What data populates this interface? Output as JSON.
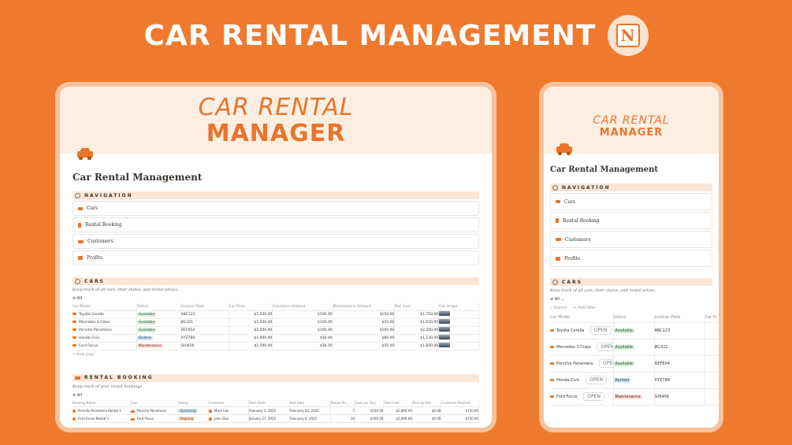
{
  "hero": {
    "title": "CAR RENTAL MANAGEMENT",
    "logo_letter": "N"
  },
  "banner": {
    "line1": "CAR RENTAL",
    "line2": "MANAGER"
  },
  "page": {
    "title": "Car Rental Management"
  },
  "navigation": {
    "heading": "NAVIGATION",
    "items": [
      "Cars",
      "Rental Booking",
      "Customers",
      "Profits"
    ]
  },
  "cars": {
    "heading": "CARS",
    "caption": "Keep track of all cars, their status, and rental prices.",
    "view": "All",
    "view_mobile": "All ⌄",
    "search": "Search",
    "add_filter": "+ Add filter",
    "columns": [
      "Car Model",
      "Status",
      "License Plate",
      "Car Price",
      "Insurance Amount",
      "Maintenance Amount",
      "Net Cost",
      "Car Image"
    ],
    "columns_mobile": [
      "Car Model",
      "Status",
      "License Plate",
      "Car Pr"
    ],
    "open_label": "OPEN",
    "new_page": "+ New page",
    "rows": [
      {
        "model": "Toyota Corolla",
        "status": "Available",
        "status_color": "green",
        "plate": "ABC123",
        "price": "$1,500.00",
        "insurance": "$100.00",
        "maintenance": "$150.00",
        "net": "$1,750.00"
      },
      {
        "model": "Mercedes S-Class",
        "status": "Available",
        "status_color": "green",
        "plate": "JKL321",
        "price": "$1,500.00",
        "insurance": "$100.00",
        "maintenance": "$50.00",
        "net": "$1,650.00"
      },
      {
        "model": "Porsche Panamera",
        "status": "Available",
        "status_color": "green",
        "plate": "DEF654",
        "price": "$2,000.00",
        "insurance": "$100.00",
        "maintenance": "$100.00",
        "net": "$2,200.00"
      },
      {
        "model": "Honda Civic",
        "status": "Rented",
        "status_color": "blue",
        "plate": "XYZ789",
        "price": "$1,000.00",
        "insurance": "$50.00",
        "maintenance": "$80.00",
        "net": "$1,130.00"
      },
      {
        "model": "Ford Focus",
        "status": "Maintenance",
        "status_color": "red",
        "plate": "GHI456",
        "price": "$1,500.00",
        "insurance": "$50.00",
        "maintenance": "$50.00",
        "net": "$1,600.00"
      }
    ]
  },
  "rental": {
    "heading": "RENTAL BOOKING",
    "caption": "Keep track of your rental bookings.",
    "view": "All",
    "columns": [
      "Booking Name",
      "Cars",
      "Status",
      "Customer",
      "Start Date",
      "End Date",
      "Rental Pe...",
      "Cost per Day",
      "Total Cost",
      "Pick Up Fee",
      "Customer Deposit"
    ],
    "rows": [
      {
        "name": "Porsche Panamera Rental 1",
        "car": "Porsche Panamera",
        "status": "Upcoming",
        "status_color": "blue",
        "customer": "Mark Lee",
        "start": "February 5, 2025",
        "end": "February 20, 2025",
        "period": "7",
        "cpd": "$150.00",
        "total": "$2,800.00",
        "pickup": "$0.00",
        "deposit": "$150.00"
      },
      {
        "name": "Ford Focus Rental 1",
        "car": "Ford Focus",
        "status": "Ongoing",
        "status_color": "orange",
        "customer": "John Doe",
        "start": "January 27, 2025",
        "end": "February 6, 2025",
        "period": "10",
        "cpd": "$200.00",
        "total": "$2,000.00",
        "pickup": "$0.00",
        "deposit": "$150.00"
      }
    ]
  },
  "colors": {
    "accent": "#e8742b",
    "background": "#ef7a2e",
    "banner": "#fcefe2",
    "section": "#fbe6d6"
  },
  "icons": [
    "notion-icon",
    "car-icon",
    "compass-icon",
    "bookmark-icon",
    "people-icon",
    "bank-icon",
    "search-icon"
  ]
}
